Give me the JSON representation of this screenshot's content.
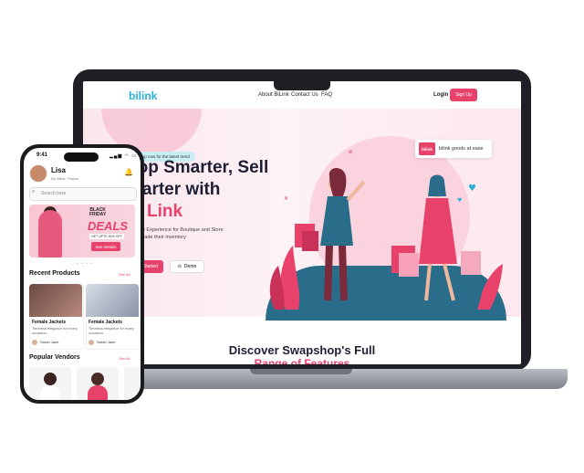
{
  "website": {
    "logo": "bilink",
    "nav_links": [
      "About BiLink",
      "Contact Us",
      "FAQ"
    ],
    "login_label": "Login",
    "signup_label": "Sign Up",
    "hero": {
      "pill_text": "shop now for the latest trend",
      "headline_line1": "hop Smarter, Sell",
      "headline_line2": "marter with",
      "headline_brand": "Link",
      "subtext_line1": "Online Experience for Boutique and Store",
      "subtext_line2": "s to Trade their Inventory",
      "cta_primary": "Started",
      "cta_demo": "Demo",
      "badge_logo": "bilink",
      "badge_text": "bilink goods at ease"
    },
    "section_title": "Discover Swapshop's Full",
    "section_subtitle": "Range of Features"
  },
  "phone": {
    "status_time": "9:41",
    "user_name": "Lisa",
    "user_location": "No West, Florida",
    "search_placeholder": "Search here",
    "banner": {
      "line1": "BLACK",
      "line2": "FRIDAY",
      "deals": "DEALS",
      "offer": "GET UPTO 50% OFF",
      "button": "See Details"
    },
    "recent_products_title": "Recent Products",
    "see_all": "See All",
    "products": [
      {
        "title": "Female Jackets",
        "desc": "Timeless elegance for every occasion.",
        "seller": "Sarah Jane"
      },
      {
        "title": "Female Jackets",
        "desc": "Timeless elegance for every occasion.",
        "seller": "Sarah Jane"
      }
    ],
    "popular_vendors_title": "Popular Vendors"
  },
  "colors": {
    "accent_pink": "#e8426b",
    "brand_blue": "#2bb0d6",
    "laptop_frame": "#1f1f25"
  }
}
